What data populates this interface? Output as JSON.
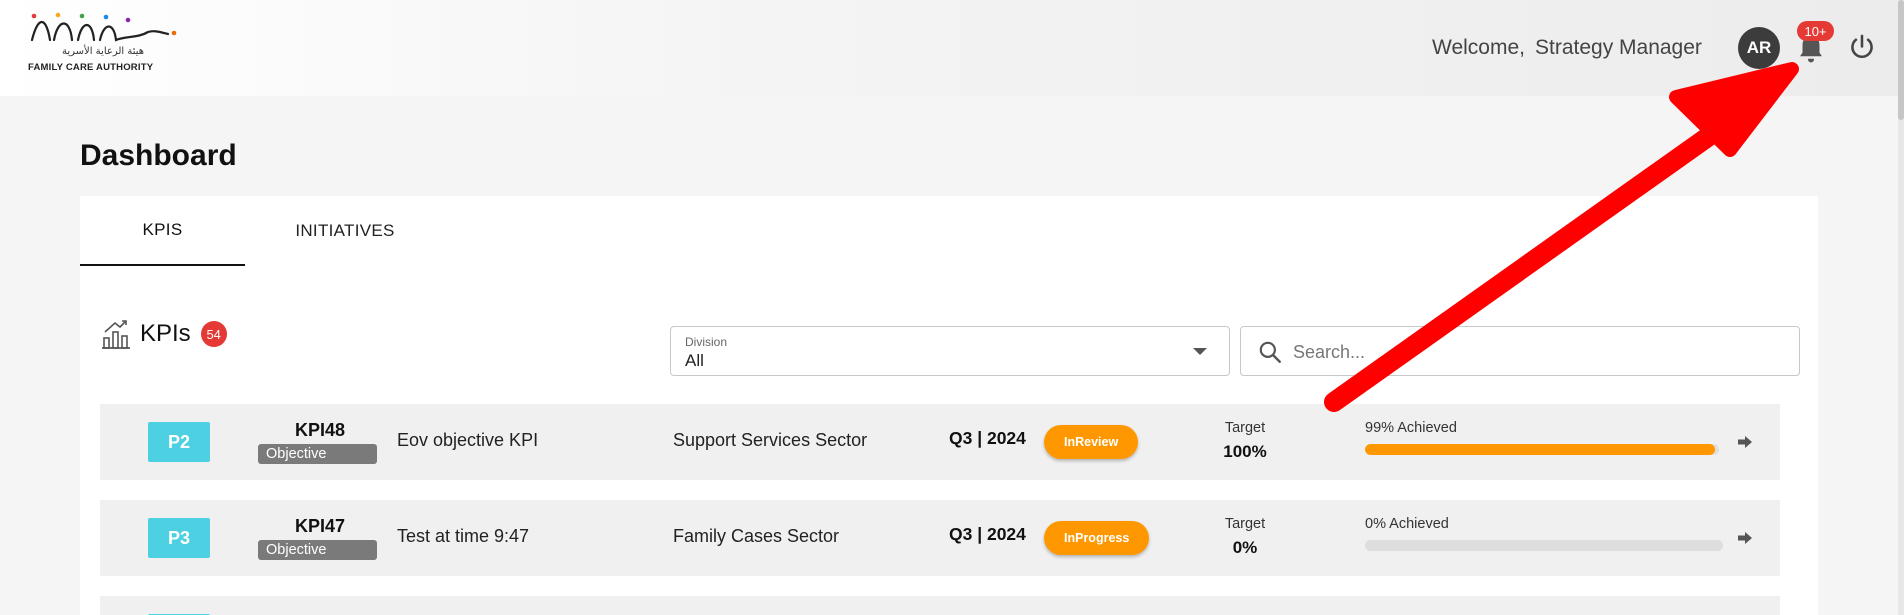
{
  "header": {
    "logo_arabic": "هيئة الرعاية الأسرية",
    "logo_english": "FAMILY CARE AUTHORITY",
    "welcome": "Welcome,",
    "user_name": "Strategy Manager",
    "avatar_initials": "AR",
    "notification_count": "10+",
    "icons": [
      "bell-icon",
      "power-icon"
    ]
  },
  "page": {
    "title": "Dashboard"
  },
  "tabs": [
    {
      "label": "KPIS",
      "active": true
    },
    {
      "label": "INITIATIVES",
      "active": false
    }
  ],
  "kpis": {
    "title": "KPIs",
    "count": "54",
    "division": {
      "label": "Division",
      "value": "All"
    },
    "search": {
      "placeholder": "Search..."
    },
    "rows": [
      {
        "priority": "P2",
        "code": "KPI48",
        "type": "Objective",
        "name": "Eov objective KPI",
        "sector": "Support Services Sector",
        "period": "Q3 | 2024",
        "status": "InReview",
        "target_label": "Target",
        "target": "100%",
        "achieved_label": "99% Achieved",
        "achieved_fraction": 0.99
      },
      {
        "priority": "P3",
        "code": "KPI47",
        "type": "Objective",
        "name": "Test at time 9:47",
        "sector": "Family Cases Sector",
        "period": "Q3 | 2024",
        "status": "InProgress",
        "target_label": "Target",
        "target": "0%",
        "achieved_label": "0% Achieved",
        "achieved_fraction": 0
      }
    ]
  },
  "colors": {
    "accent_badge": "#e53935",
    "priority": "#4dd0e1",
    "status": "#ff9800",
    "annotation_arrow": "#ff0000"
  }
}
